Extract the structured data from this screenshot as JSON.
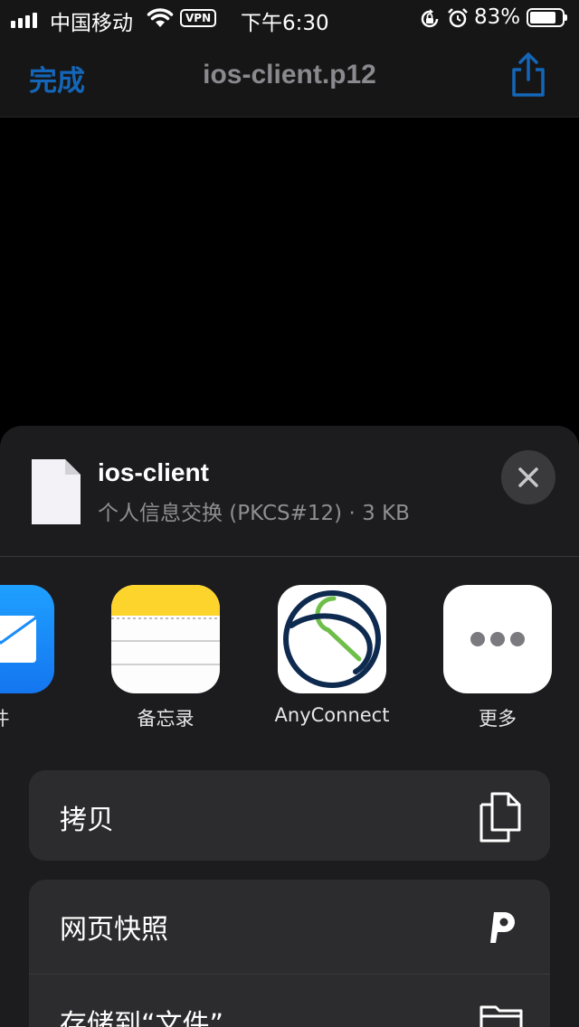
{
  "status_bar": {
    "carrier": "中国移动",
    "vpn_label": "VPN",
    "time": "下午6:30",
    "battery_percent_text": "83%",
    "battery_level": 0.83
  },
  "nav": {
    "done_label": "完成",
    "title": "ios-client.p12",
    "accent_color": "#1466b8"
  },
  "file": {
    "name": "ios-client",
    "meta": "个人信息交换 (PKCS#12) · 3 KB"
  },
  "apps": [
    {
      "label": "件",
      "icon": "mail-icon"
    },
    {
      "label": "备忘录",
      "icon": "notes-icon"
    },
    {
      "label": "AnyConnect",
      "icon": "anyconnect-icon"
    },
    {
      "label": "更多",
      "icon": "more-icon"
    }
  ],
  "actions": [
    {
      "label": "拷贝",
      "icon": "copy-icon"
    },
    {
      "label": "网页快照",
      "icon": "pinterest-icon"
    },
    {
      "label": "存储到“文件”",
      "icon": "folder-icon"
    }
  ]
}
